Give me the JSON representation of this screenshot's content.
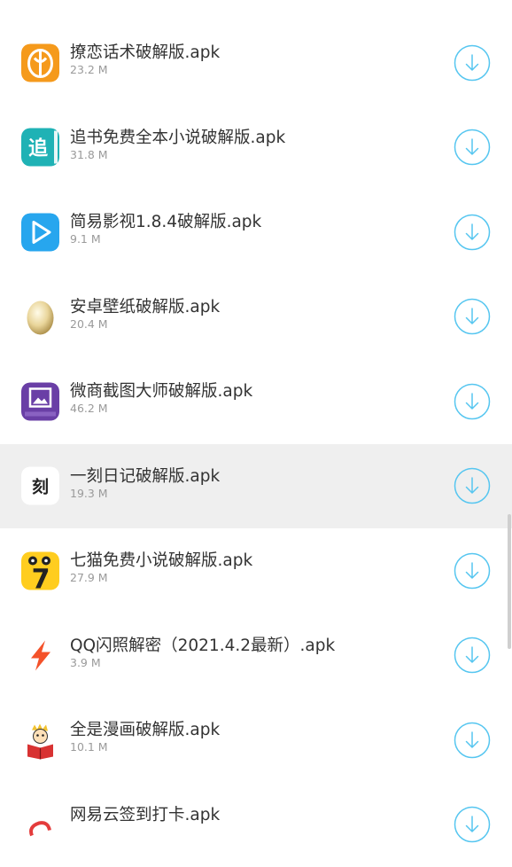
{
  "colors": {
    "accent": "#56c6f0",
    "active_row_bg": "#efefef",
    "name_text": "#333333",
    "size_text": "#9a9a9a"
  },
  "files": [
    {
      "name": "撩恋话术破解版.apk",
      "size": "23.2 M",
      "icon": "flirt-app-icon",
      "active": false
    },
    {
      "name": "追书免费全本小说破解版.apk",
      "size": "31.8 M",
      "icon": "zhuishu-app-icon",
      "icon_text": "追",
      "active": false
    },
    {
      "name": "简易影视1.8.4破解版.apk",
      "size": "9.1 M",
      "icon": "video-player-app-icon",
      "active": false
    },
    {
      "name": "安卓壁纸破解版.apk",
      "size": "20.4 M",
      "icon": "egg-wallpaper-app-icon",
      "active": false
    },
    {
      "name": "微商截图大师破解版.apk",
      "size": "46.2 M",
      "icon": "screenshot-master-app-icon",
      "active": false
    },
    {
      "name": "一刻日记破解版.apk",
      "size": "19.3 M",
      "icon": "yike-diary-app-icon",
      "icon_text": "刻",
      "active": true
    },
    {
      "name": "七猫免费小说破解版.apk",
      "size": "27.9 M",
      "icon": "qimao-novel-app-icon",
      "icon_text": "7",
      "active": false
    },
    {
      "name": "QQ闪照解密（2021.4.2最新）.apk",
      "size": "3.9 M",
      "icon": "lightning-app-icon",
      "active": false
    },
    {
      "name": "全是漫画破解版.apk",
      "size": "10.1 M",
      "icon": "comic-reader-app-icon",
      "active": false
    },
    {
      "name": "网易云签到打卡.apk",
      "size": "",
      "icon": "netease-music-app-icon",
      "active": false
    }
  ]
}
